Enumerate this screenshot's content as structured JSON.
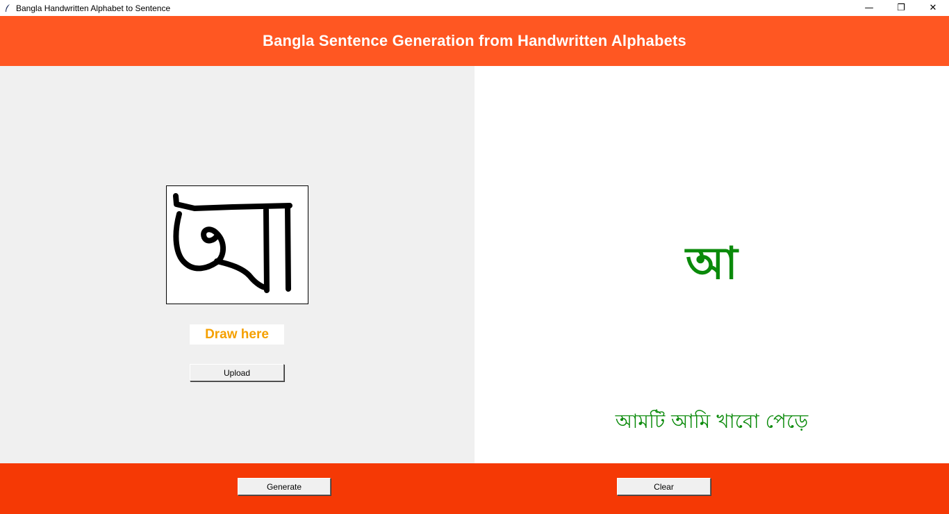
{
  "window": {
    "title": "Bangla Handwritten Alphabet to Sentence",
    "icon": "feather-icon",
    "controls": {
      "minimize": "—",
      "restore": "❐",
      "close": "✕"
    }
  },
  "header": {
    "title": "Bangla Sentence Generation from Handwritten Alphabets",
    "color": "#ff5722"
  },
  "left_panel": {
    "draw_label": "Draw here",
    "upload_label": "Upload",
    "drawn_character": "অ"
  },
  "right_panel": {
    "predicted_character": "আ",
    "generated_sentence": "আমটি আমি খাবো পেড়ে",
    "text_color": "#0a8a0a"
  },
  "footer": {
    "generate_label": "Generate",
    "clear_label": "Clear",
    "color": "#f53905"
  }
}
